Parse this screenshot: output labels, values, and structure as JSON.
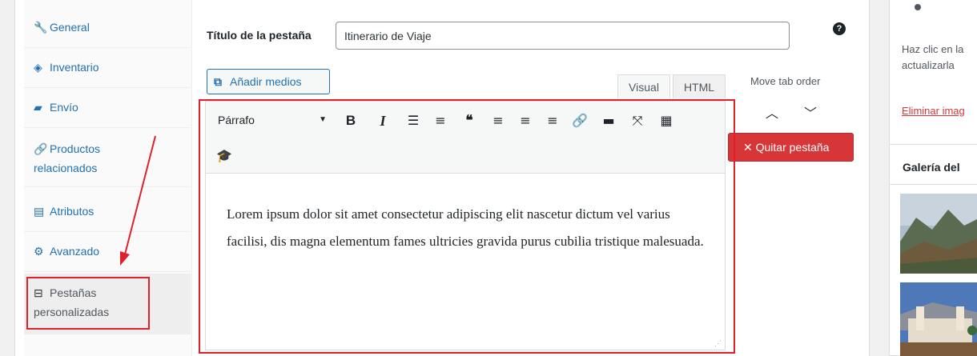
{
  "tabs": [
    {
      "label": "General",
      "icon": "wrench-icon"
    },
    {
      "label": "Inventario",
      "icon": "tag-icon"
    },
    {
      "label": "Envío",
      "icon": "truck-icon"
    },
    {
      "label_line1": "Productos",
      "label_line2": "relacionados",
      "icon": "link-icon"
    },
    {
      "label": "Atributos",
      "icon": "table-icon"
    },
    {
      "label": "Avanzado",
      "icon": "gear-icon"
    },
    {
      "label_line1": "Pestañas",
      "label_line2": "personalizadas",
      "icon": "panel-icon"
    }
  ],
  "form": {
    "title_label": "Título de la pestaña",
    "title_value": "Itinerario de Viaje"
  },
  "editor": {
    "add_media_label": "Añadir medios",
    "tab_visual": "Visual",
    "tab_html": "HTML",
    "format_value": "Párrafo",
    "content": "Lorem ipsum dolor sit amet consectetur adipiscing elit nascetur dictum vel varius facilisi, dis magna elementum fames ultricies gravida purus cubilia tristique malesuada."
  },
  "tab_order": {
    "label": "Move tab order",
    "remove_label": "Quitar pestaña"
  },
  "sidebar": {
    "help_text_line1": "Haz clic en la",
    "help_text_line2": "actualizarla",
    "remove_image_link": "Eliminar imag",
    "gallery_title": "Galería del"
  },
  "colors": {
    "accent": "#2271b1",
    "danger": "#d63638",
    "highlight": "#e0202a"
  }
}
